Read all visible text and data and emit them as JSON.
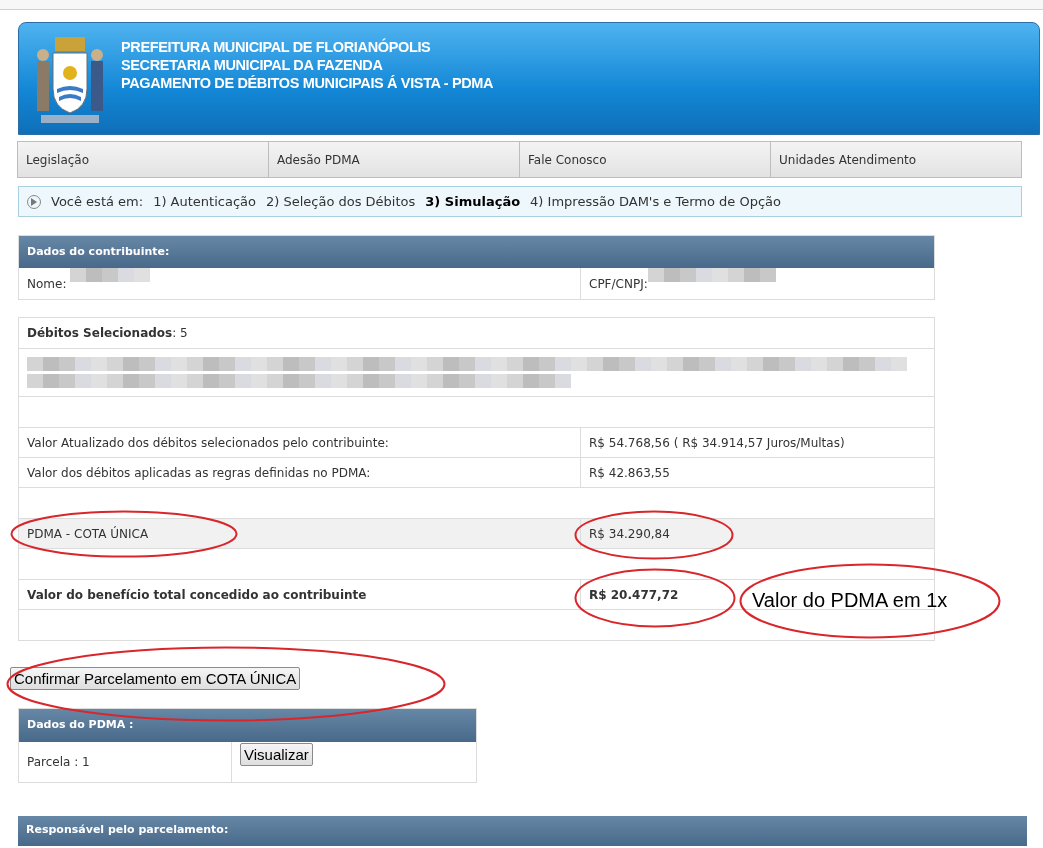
{
  "header": {
    "lines": [
      "PREFEITURA MUNICIPAL DE FLORIANÓPOLIS",
      "SECRETARIA MUNICIPAL DA FAZENDA",
      "PAGAMENTO DE DÉBITOS MUNICIPAIS Á VISTA - PDMA"
    ]
  },
  "nav": [
    {
      "label": "Legislação"
    },
    {
      "label": "Adesão PDMA"
    },
    {
      "label": "Fale Conosco"
    },
    {
      "label": "Unidades Atendimento"
    }
  ],
  "breadcrumb": {
    "prefix": "Você está em:",
    "steps": [
      {
        "label": "1) Autenticação",
        "selected": false
      },
      {
        "label": "2) Seleção dos Débitos",
        "selected": false
      },
      {
        "label": "3) Simulação",
        "selected": true
      },
      {
        "label": "4) Impressão DAM's e Termo de Opção",
        "selected": false
      }
    ]
  },
  "contribuinte": {
    "title": "Dados do contribuinte:",
    "name_label": "Nome:",
    "doc_label": "CPF/CNPJ:"
  },
  "debitos": {
    "heading": "**Débitos Selecionados**: 5",
    "rows": [
      {
        "kind": "blank"
      },
      {
        "kind": "plain",
        "label": "Valor Atualizado dos débitos selecionados pelo contribuinte:",
        "value": "R$ 54.768,56 ( R$ 34.914,57 Juros/Multas)"
      },
      {
        "kind": "plain",
        "label": "Valor dos débitos aplicadas as regras definidas no PDMA:",
        "value": "R$ 42.863,55"
      },
      {
        "kind": "blank"
      },
      {
        "kind": "shaded",
        "label": "PDMA - COTA ÚNICA",
        "value": "R$ 34.290,84"
      },
      {
        "kind": "blank"
      },
      {
        "kind": "bold",
        "label": "Valor do benefício total concedido ao contribuinte",
        "value": "R$ 20.477,72"
      },
      {
        "kind": "blank"
      }
    ]
  },
  "annotation": "Valor do PDMA em 1x",
  "confirm_button": "Confirmar Parcelamento em COTA ÚNICA",
  "pdma": {
    "title": "Dados do PDMA :",
    "parcela": "Parcela : 1",
    "button": "Visualizar"
  },
  "responsavel": {
    "title": "Responsável pelo parcelamento:"
  }
}
